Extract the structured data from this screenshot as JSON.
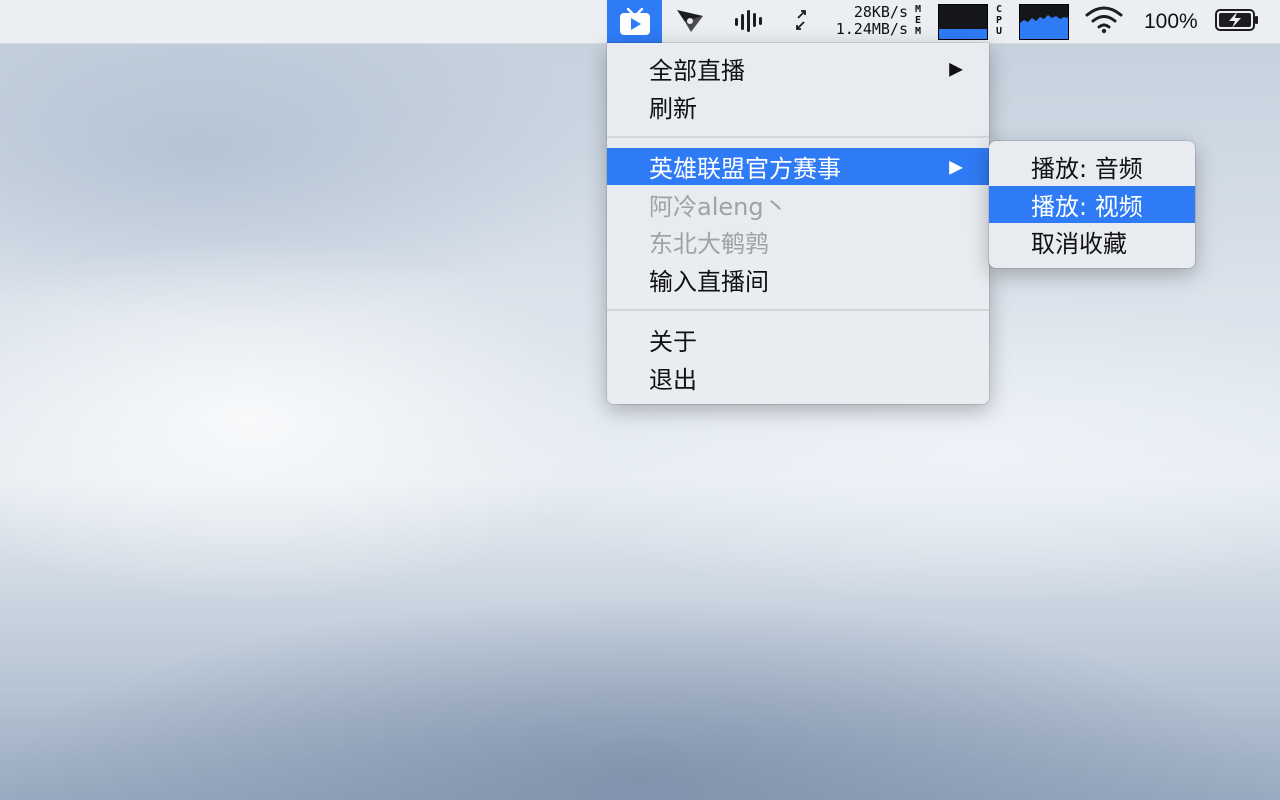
{
  "menubar": {
    "net_up": "28KB/s",
    "net_down": "1.24MB/s",
    "mem_label": "MEM",
    "cpu_label": "CPU",
    "battery_pct": "100%",
    "icons": [
      "tv-app-icon",
      "paper-plane-icon",
      "audio-waveform-icon",
      "network-arrows-icon",
      "wifi-icon",
      "battery-charging-icon"
    ]
  },
  "main_menu": {
    "items": [
      {
        "label": "全部直播",
        "submenu": true
      },
      {
        "label": "刷新"
      },
      {
        "label": "英雄联盟官方赛事",
        "submenu": true,
        "selected": true
      },
      {
        "label": "阿冷aleng丶",
        "disabled": true
      },
      {
        "label": "东北大鹌鹑",
        "disabled": true
      },
      {
        "label": "输入直播间"
      },
      {
        "label": "关于"
      },
      {
        "label": "退出"
      }
    ],
    "arrow_glyph": "▶"
  },
  "sub_menu": {
    "items": [
      {
        "label": "播放: 音频"
      },
      {
        "label": "播放: 视频",
        "selected": true
      },
      {
        "label": "取消收藏"
      }
    ]
  },
  "colors": {
    "accent": "#2f7bf5",
    "menu_bg": "#e9ecf0",
    "disabled_text": "#9fa3a8"
  }
}
